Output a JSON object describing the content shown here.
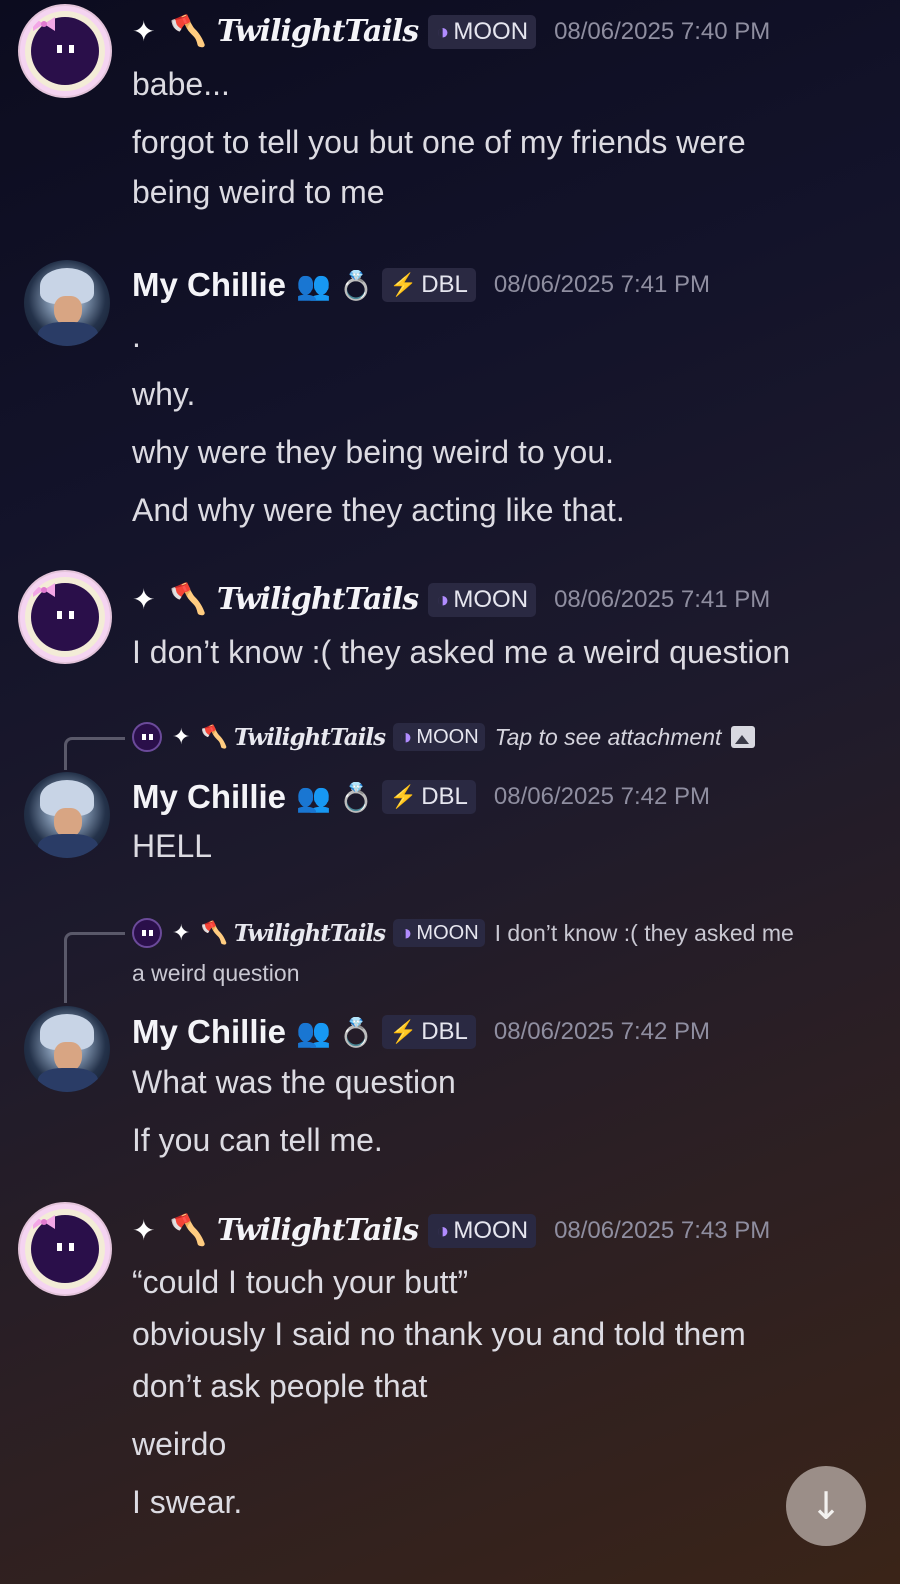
{
  "users": {
    "twilight": {
      "name": "TwilightTails",
      "tag": "MOON",
      "prefix": "✦",
      "axe": "🪓"
    },
    "chillie": {
      "name": "My Chillie",
      "tag": "DBL",
      "emoji_people": "👥",
      "emoji_ring": "💍"
    }
  },
  "messages": [
    {
      "author": "twilight",
      "timestamp": "08/06/2025 7:40 PM",
      "lines": [
        "babe...",
        "forgot to tell you but one of my friends were",
        "being weird to me"
      ]
    },
    {
      "author": "chillie",
      "timestamp": "08/06/2025 7:41 PM",
      "lines": [
        ".",
        "why.",
        "why were they being weird to you.",
        "And why were they acting like that."
      ]
    },
    {
      "author": "twilight",
      "timestamp": "08/06/2025 7:41 PM",
      "lines": [
        "I don’t know :( they asked me a weird question"
      ]
    },
    {
      "author": "chillie",
      "timestamp": "08/06/2025 7:42 PM",
      "reply": {
        "author": "twilight",
        "text": "Tap to see attachment"
      },
      "lines": [
        "HELL"
      ]
    },
    {
      "author": "chillie",
      "timestamp": "08/06/2025 7:42 PM",
      "reply": {
        "author": "twilight",
        "text": "I don’t know :( they asked me",
        "text_wrap": "a weird question"
      },
      "lines": [
        "What was the question",
        "If you can tell me."
      ]
    },
    {
      "author": "twilight",
      "timestamp": "08/06/2025 7:43 PM",
      "lines": [
        "“could I touch your butt”",
        "obviously I said no thank you and told them",
        "don’t ask people that",
        "weirdo",
        "I swear."
      ]
    }
  ],
  "icons": {
    "moon": "moon-icon",
    "dbl": "lightning-icon",
    "scroll": "arrow-down-icon",
    "attachment": "image-icon"
  },
  "colors": {
    "moon_icon": "#b18cff",
    "dbl_icon": "#ffd02a",
    "tag_bg": "#2a2942",
    "timestamp": "#8f8ea0"
  },
  "scroll_button": {
    "glyph": "↓"
  }
}
